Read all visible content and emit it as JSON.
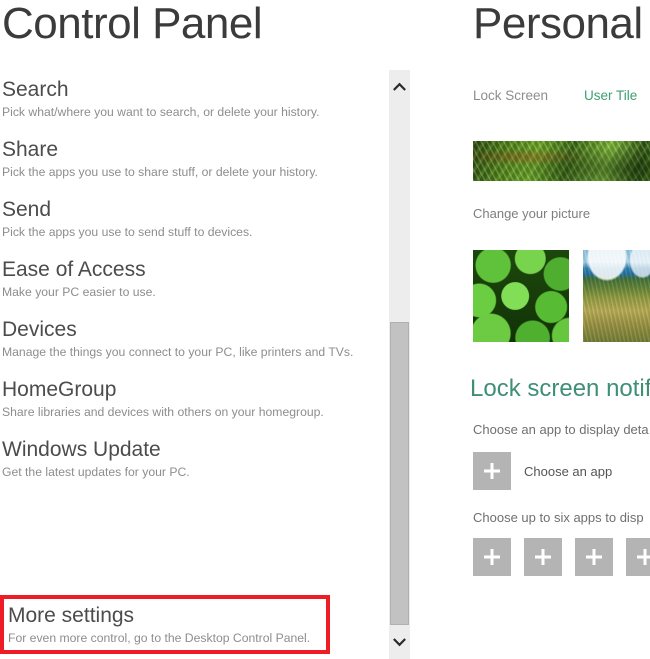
{
  "left": {
    "title": "Control Panel",
    "settings": [
      {
        "title": "Search",
        "desc": "Pick what/where you want to search, or delete your history."
      },
      {
        "title": "Share",
        "desc": "Pick the apps you use to share stuff, or delete your history."
      },
      {
        "title": "Send",
        "desc": "Pick the apps you use to send stuff to devices."
      },
      {
        "title": "Ease of Access",
        "desc": "Make your PC easier to use."
      },
      {
        "title": "Devices",
        "desc": "Manage the things you connect to your PC, like printers and TVs."
      },
      {
        "title": "HomeGroup",
        "desc": "Share libraries and devices with others on your homegroup."
      },
      {
        "title": "Windows Update",
        "desc": "Get the latest updates for your PC."
      }
    ],
    "highlighted": {
      "title": "More settings",
      "desc": "For even more control, go to the Desktop Control Panel.",
      "highlight_color": "#ee1c25"
    }
  },
  "scrollbar": {
    "up_arrow_icon": "chevron-up-icon",
    "down_arrow_icon": "chevron-down-icon",
    "track_color": "#ededed",
    "thumb_color": "#c2c2c2"
  },
  "right": {
    "title": "Personal",
    "accent_color": "#3da06f",
    "heading_color": "#3f8f77",
    "tabs": [
      {
        "label": "Lock Screen",
        "active": false
      },
      {
        "label": "User Tile",
        "active": true
      }
    ],
    "change_picture_label": "Change your picture",
    "picture_thumbs": [
      {
        "name": "clover-picture"
      },
      {
        "name": "coastal-landscape-picture"
      }
    ],
    "lock_screen_heading": "Lock screen notifi",
    "choose_app_detail_label": "Choose an app to display deta",
    "choose_app_button_label": "Choose an app",
    "choose_six_apps_label": "Choose up to six apps to disp",
    "quick_status_slots": 4
  }
}
